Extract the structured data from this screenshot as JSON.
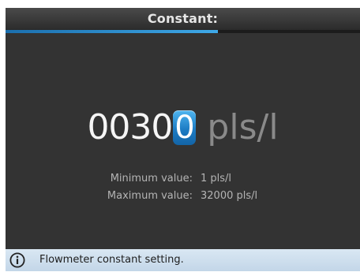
{
  "header": {
    "title": "Constant:",
    "progress_fraction": 0.6
  },
  "editor": {
    "value_prefix": "0030",
    "cursor_digit": "0",
    "unit": "pls/l"
  },
  "limits": {
    "min_label": "Minimum value:",
    "min_value": "1 pls/l",
    "max_label": "Maximum value:",
    "max_value": "32000 pls/l"
  },
  "status": {
    "icon": "info-icon",
    "text": "Flowmeter constant setting."
  },
  "colors": {
    "accent": "#2d8fd6",
    "background": "#333333",
    "status_bar": "#cfdfee"
  }
}
